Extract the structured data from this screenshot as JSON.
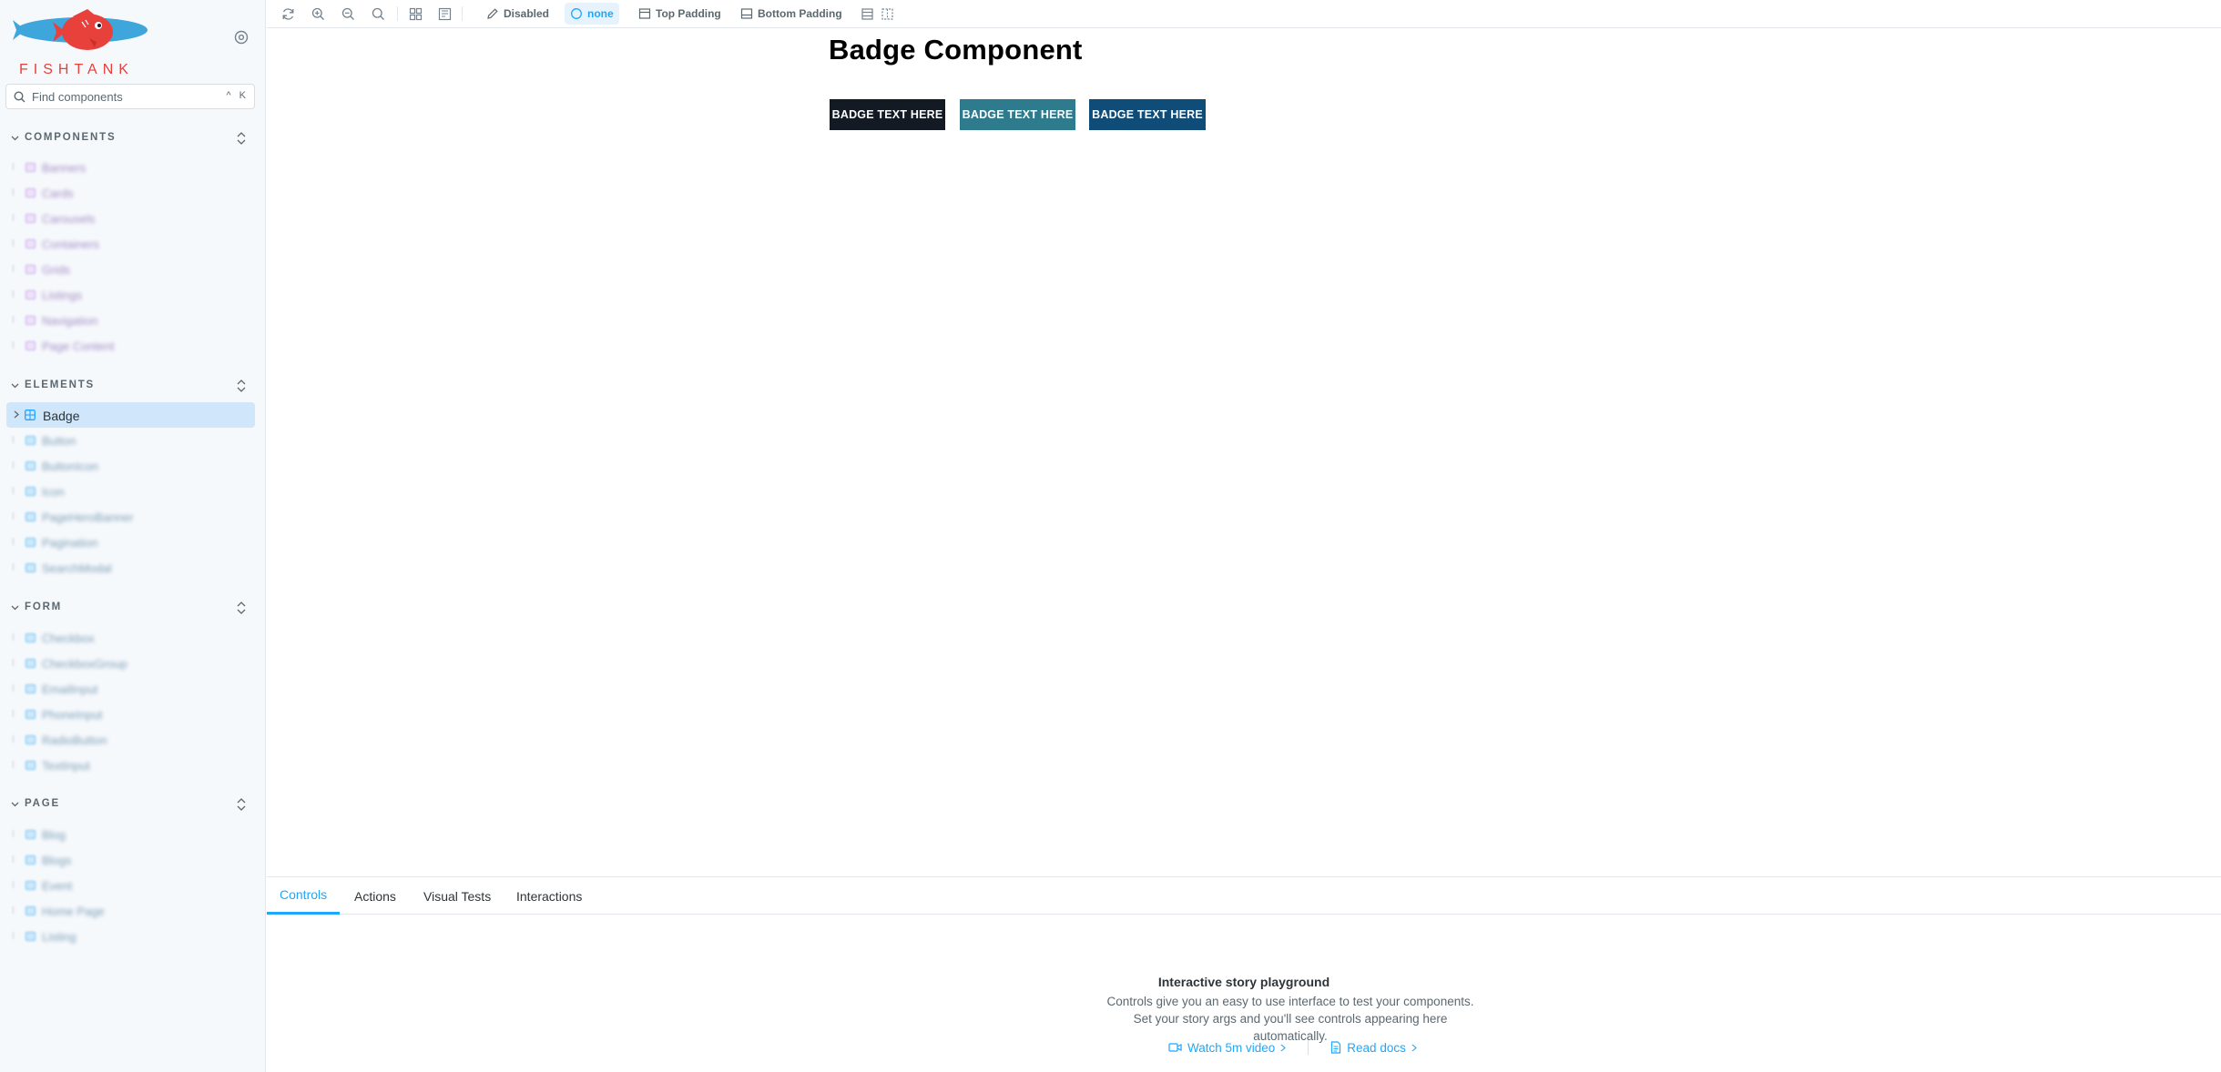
{
  "brand": {
    "name": "FISHTANK"
  },
  "search": {
    "placeholder": "Find components",
    "shortcut": "^ K"
  },
  "sidebar": {
    "sections": [
      {
        "title": "COMPONENTS",
        "items": [
          "Banners",
          "Cards",
          "Carousels",
          "Containers",
          "Grids",
          "Listings",
          "Navigation",
          "Page Content"
        ]
      },
      {
        "title": "ELEMENTS",
        "selected": "Badge",
        "items": [
          "Button",
          "ButtonIcon",
          "Icon",
          "PageHeroBanner",
          "Pagination",
          "SearchModal"
        ]
      },
      {
        "title": "FORM",
        "items": [
          "Checkbox",
          "CheckboxGroup",
          "EmailInput",
          "PhoneInput",
          "RadioButton",
          "TextInput"
        ]
      },
      {
        "title": "PAGE",
        "items": [
          "Blog",
          "Blogs",
          "Event",
          "Home Page",
          "Listing"
        ]
      }
    ]
  },
  "toolbar": {
    "disabled_label": "Disabled",
    "none_label": "none",
    "top_padding_label": "Top Padding",
    "bottom_padding_label": "Bottom Padding"
  },
  "canvas": {
    "title": "Badge Component",
    "badges": [
      {
        "text": "BADGE TEXT HERE",
        "color": "#131a24"
      },
      {
        "text": "BADGE TEXT HERE",
        "color": "#2d7b8c"
      },
      {
        "text": "BADGE TEXT HERE",
        "color": "#0f4c78"
      }
    ]
  },
  "panel": {
    "tabs": [
      "Controls",
      "Actions",
      "Visual Tests",
      "Interactions"
    ],
    "active_tab": "Controls",
    "empty_title": "Interactive story playground",
    "empty_desc": "Controls give you an easy to use interface to test your components. Set your story args and you'll see controls appearing here automatically.",
    "video_link": "Watch 5m video",
    "docs_link": "Read docs"
  },
  "colors": {
    "accent": "#1ea7fd",
    "brand_red": "#e8403a",
    "brand_blue": "#3fa6dc"
  }
}
